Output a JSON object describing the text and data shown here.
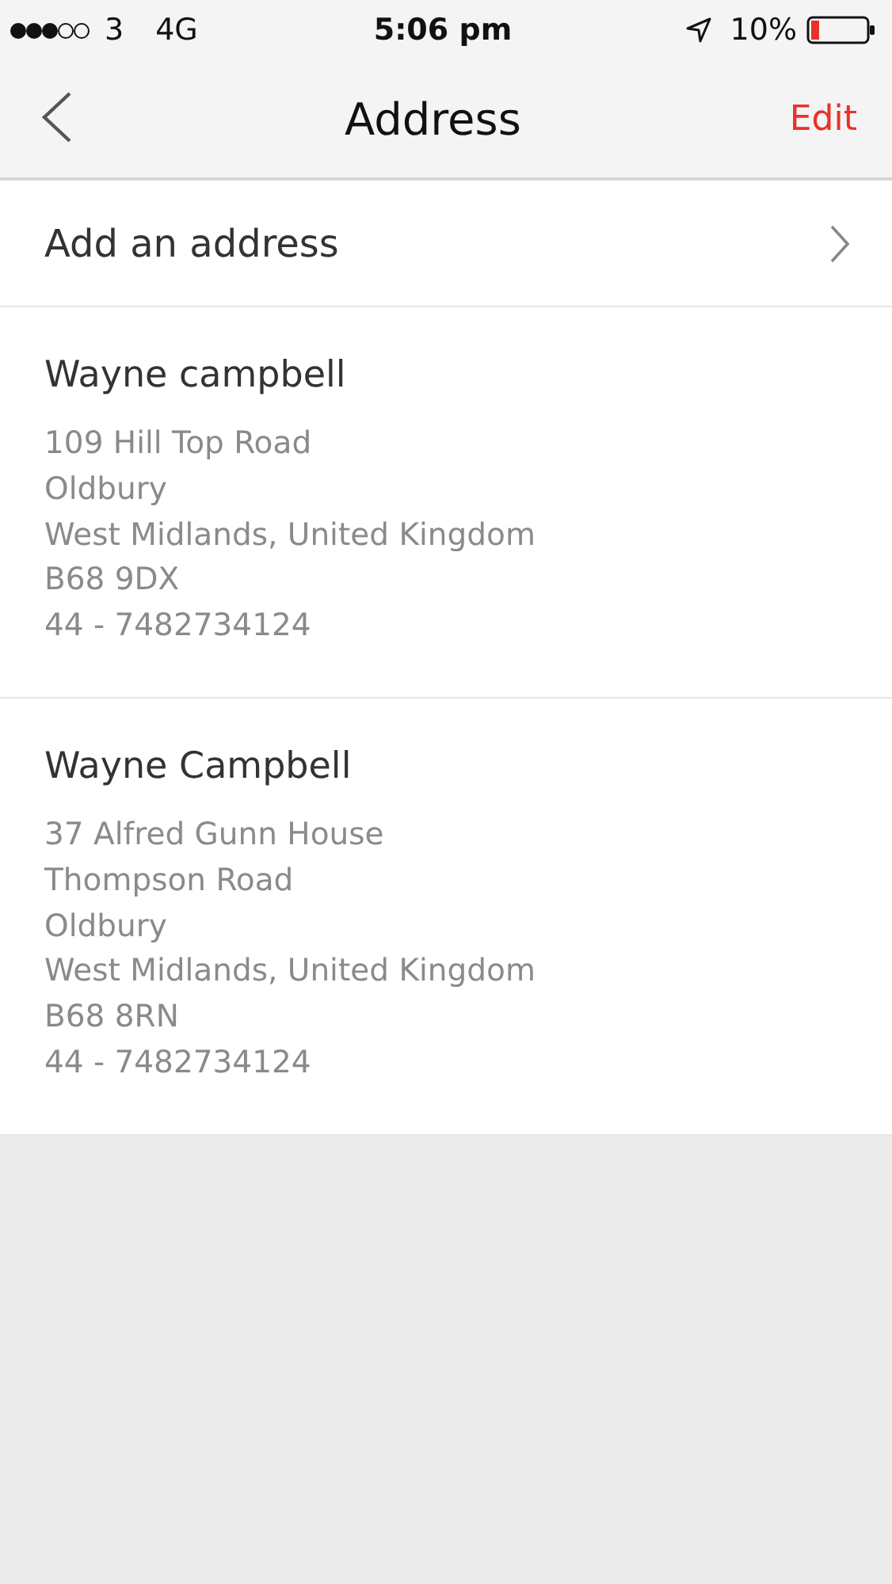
{
  "status_bar": {
    "carrier": "3",
    "network": "4G",
    "time": "5:06 pm",
    "battery": "10%"
  },
  "nav": {
    "title": "Address",
    "action": "Edit"
  },
  "add_row": {
    "label": "Add an address"
  },
  "addresses": [
    {
      "name": "Wayne campbell",
      "lines": [
        "109 Hill Top Road",
        "Oldbury",
        "West Midlands, United Kingdom",
        "B68 9DX",
        "44 - 7482734124"
      ]
    },
    {
      "name": "Wayne Campbell",
      "lines": [
        "37 Alfred Gunn House",
        "Thompson Road",
        "Oldbury",
        "West Midlands, United Kingdom",
        "B68 8RN",
        "44 - 7482734124"
      ]
    }
  ]
}
